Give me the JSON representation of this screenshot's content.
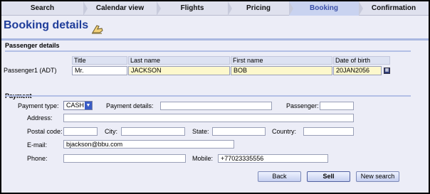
{
  "steps": [
    {
      "label": "Search"
    },
    {
      "label": "Calendar view"
    },
    {
      "label": "Flights"
    },
    {
      "label": "Pricing"
    },
    {
      "label": "Booking"
    },
    {
      "label": "Confirmation"
    }
  ],
  "active_step": "Booking",
  "page": {
    "title": "Booking details"
  },
  "passenger_section": {
    "label": "Passenger details",
    "columns": {
      "title": "Title",
      "last_name": "Last name",
      "first_name": "First name",
      "dob": "Date of birth"
    },
    "row": {
      "label": "Passenger1 (ADT)",
      "title": "Mr.",
      "last_name": "JACKSON",
      "first_name": "BOB",
      "dob": "20JAN2056"
    }
  },
  "payment_section": {
    "label": "Payment",
    "payment_type_label": "Payment type:",
    "payment_type_value": "CASH",
    "payment_details_label": "Payment details:",
    "payment_details_value": "",
    "passenger_label": "Passenger:",
    "passenger_value": "",
    "address_label": "Address:",
    "address_value": "",
    "postal_code_label": "Postal code:",
    "postal_code_value": "",
    "city_label": "City:",
    "city_value": "",
    "state_label": "State:",
    "state_value": "",
    "country_label": "Country:",
    "country_value": "",
    "email_label": "E-mail:",
    "email_value": "bjackson@bbu.com",
    "phone_label": "Phone:",
    "phone_value": "",
    "mobile_label": "Mobile:",
    "mobile_value": "+77023335556"
  },
  "buttons": {
    "back": "Back",
    "sell": "Sell",
    "new_search": "New search"
  }
}
